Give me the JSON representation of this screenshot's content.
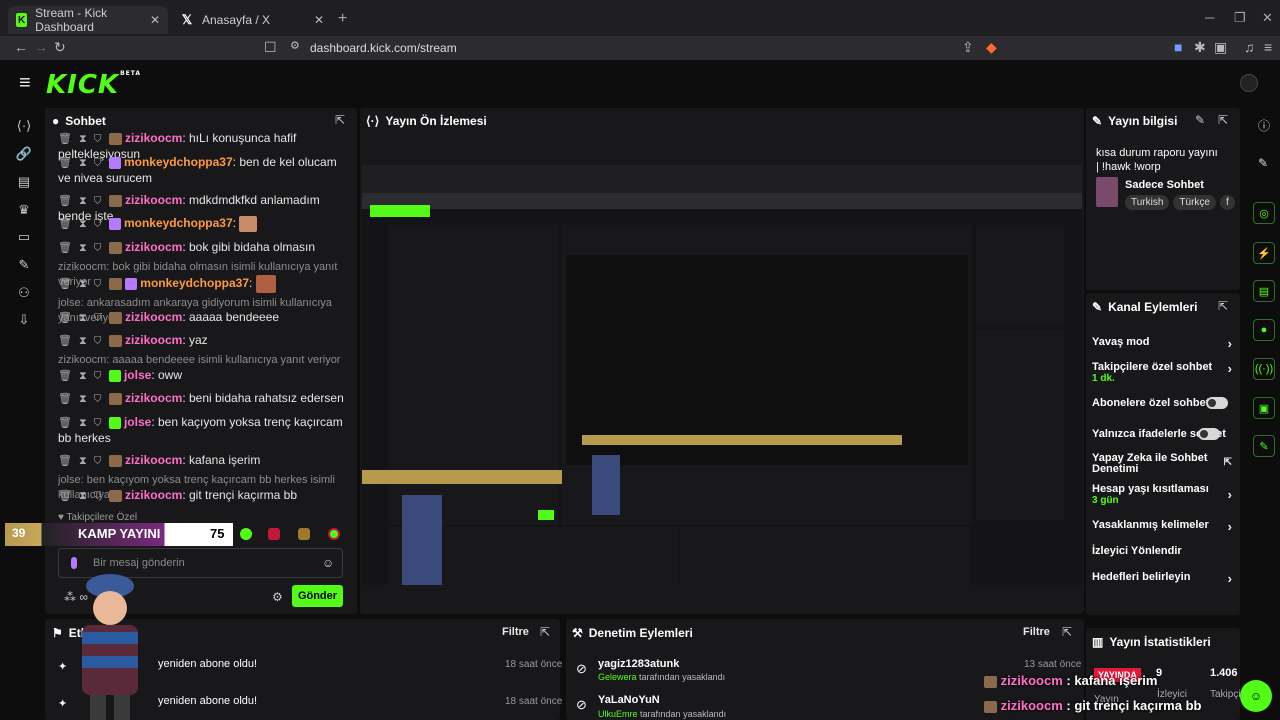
{
  "browser": {
    "tabs": [
      {
        "title": "Stream - Kick Dashboard"
      },
      {
        "title": "Anasayfa / X"
      }
    ],
    "url": "dashboard.kick.com/stream"
  },
  "app": {
    "logo": "KICK",
    "logo_badge": "BETA"
  },
  "chat": {
    "title": "Sohbet",
    "messages": [
      {
        "user": "zizikoocm",
        "text": "hıLı konuşunca hafif peltekleşiyosun"
      },
      {
        "user": "monkeydchoppa37",
        "text": "ben de kel olucam ve nivea surucem"
      },
      {
        "user": "zizikoocm",
        "text": "mdkdmdkfkd anlamadım bende işte"
      },
      {
        "user": "monkeydchoppa37",
        "text": ""
      },
      {
        "user": "zizikoocm",
        "text": "bok gibi bidaha olmasın"
      },
      {
        "reply": "zizikoocm: bok gibi bidaha olmasın isimli kullanıcıya yanıt veriyor"
      },
      {
        "user": "monkeydchoppa37",
        "text": ""
      },
      {
        "reply": "jolse: ankarasadım ankaraya gidiyorum isimli kullanıcıya yanıt veriyor"
      },
      {
        "user": "zizikoocm",
        "text": "aaaaa bendeeee"
      },
      {
        "user": "zizikoocm",
        "text": "yaz"
      },
      {
        "reply": "zizikoocm: aaaaa bendeeee isimli kullanıcıya yanıt veriyor"
      },
      {
        "user": "jolse",
        "text": "oww"
      },
      {
        "user": "zizikoocm",
        "text": "beni bidaha rahatsız edersen"
      },
      {
        "user": "jolse",
        "text": "ben kaçıyom yoksa trenç kaçırcam bb herkes"
      },
      {
        "user": "zizikoocm",
        "text": "kafana işerim"
      },
      {
        "reply": "jolse: ben kaçıyom yoksa trenç kaçırcam bb herkes isimli kullanıcıya ..."
      },
      {
        "user": "zizikoocm",
        "text": "git trençi kaçırma bb"
      }
    ],
    "followers_label": "Takipçilere Özel",
    "input_placeholder": "Bir mesaj gönderin",
    "send_label": "Gönder",
    "kamp_level": "39",
    "kamp_label": "KAMP YAYINI",
    "kamp_count": "75"
  },
  "preview": {
    "title": "Yayın Ön İzlemesi"
  },
  "stream_info": {
    "title": "Yayın bilgisi",
    "stream_title": "kısa durum raporu yayını | !hawk !worp",
    "category": "Sadece Sohbet",
    "tags": [
      "Turkish",
      "Türkçe",
      "f"
    ]
  },
  "channel_actions": {
    "title": "Kanal Eylemleri",
    "items": [
      {
        "label": "Yavaş mod",
        "sub": ""
      },
      {
        "label": "Takipçilere özel sohbet",
        "sub": "1 dk."
      },
      {
        "label": "Abonelere özel sohbet",
        "sub": ""
      },
      {
        "label": "Yalnızca ifadelerle sohbet",
        "sub": ""
      },
      {
        "label": "Yapay Zeka ile Sohbet Denetimi",
        "sub": ""
      },
      {
        "label": "Hesap yaşı kısıtlaması",
        "sub": "3 gün"
      },
      {
        "label": "Yasaklanmış kelimeler",
        "sub": ""
      },
      {
        "label": "İzleyici Yönlendir",
        "sub": ""
      },
      {
        "label": "Hedefleri belirleyin",
        "sub": ""
      }
    ]
  },
  "events": {
    "title": "Etkinlikler",
    "filter": "Filtre",
    "items": [
      {
        "text": "yeniden abone oldu!",
        "time": "18 saat önce"
      },
      {
        "text": "yeniden abone oldu!",
        "time": "18 saat önce"
      }
    ]
  },
  "moderation": {
    "title": "Denetim Eylemleri",
    "filter": "Filtre",
    "items": [
      {
        "user": "yagiz1283atunk",
        "by": "Gelewera",
        "action": "tarafından yasaklandı",
        "time": "13 saat önce"
      },
      {
        "user": "YaLaNoYuN",
        "by": "UlkuEmre",
        "action": "tarafından yasaklandı",
        "time": "13 saat önce"
      }
    ]
  },
  "stats": {
    "title": "Yayın İstatistikleri",
    "live": "YAYINDA",
    "viewers_num": "9",
    "followers_num": "1.406",
    "labels": [
      "Yayın",
      "İzleyici",
      "Takipçi"
    ]
  },
  "overlay": {
    "line1_user": "zizikoocm",
    "line1_text": ": kafana işerim",
    "line2_user": "zizikoocm",
    "line2_text": ": git trençi kaçırma bb"
  },
  "colors": {
    "accent": "#53fc18",
    "panel": "#18181b",
    "bg": "#0d0d0e"
  }
}
